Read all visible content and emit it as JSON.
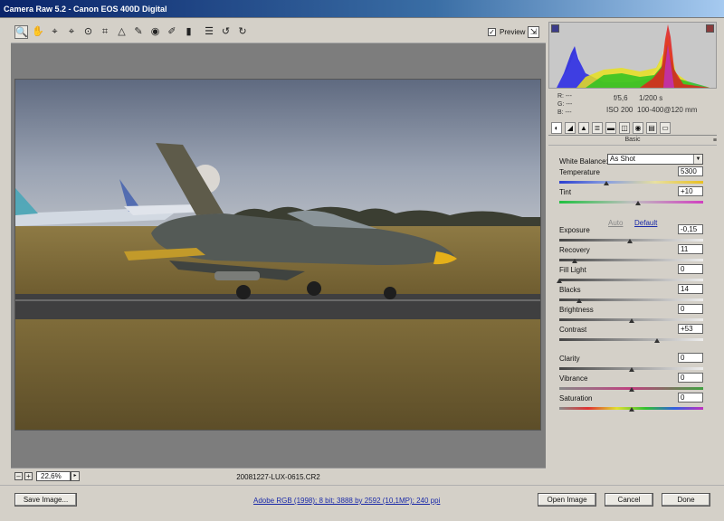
{
  "window": {
    "title": "Camera Raw 5.2  -  Canon EOS 400D Digital"
  },
  "toolbar": {
    "tools": [
      {
        "name": "zoom-tool-icon",
        "glyph": "🔍"
      },
      {
        "name": "hand-tool-icon",
        "glyph": "✋"
      },
      {
        "name": "white-balance-tool-icon",
        "glyph": "⌖"
      },
      {
        "name": "color-sampler-tool-icon",
        "glyph": "⌖"
      },
      {
        "name": "targeted-adjustment-tool-icon",
        "glyph": "⊙"
      },
      {
        "name": "crop-tool-icon",
        "glyph": "⌗"
      },
      {
        "name": "straighten-tool-icon",
        "glyph": "△"
      },
      {
        "name": "spot-removal-tool-icon",
        "glyph": "✎"
      },
      {
        "name": "red-eye-removal-tool-icon",
        "glyph": "◉"
      },
      {
        "name": "adjustment-brush-icon",
        "glyph": "✐"
      },
      {
        "name": "graduated-filter-icon",
        "glyph": "▮"
      },
      {
        "name": "preferences-icon",
        "glyph": "☰"
      },
      {
        "name": "rotate-left-icon",
        "glyph": "↺"
      },
      {
        "name": "rotate-right-icon",
        "glyph": "↻"
      }
    ],
    "preview_label": "Preview",
    "preview_checked": "✓"
  },
  "status": {
    "zoom": "22,6%",
    "filename": "20081227-LUX-0615.CR2",
    "zoom_out": "–",
    "zoom_in": "+",
    "zoom_menu": "▸"
  },
  "readout": {
    "r": "R:   ---",
    "g": "G:   ---",
    "b": "B:   ---",
    "aperture": "f/5,6",
    "shutter": "1/200 s",
    "iso": "ISO 200",
    "lens": "100-400@120 mm"
  },
  "panel": {
    "section_title": "Basic",
    "menu_glyph": "≡",
    "white_balance_label": "White Balance:",
    "white_balance_value": "As Shot",
    "auto_label": "Auto",
    "default_label": "Default",
    "sliders": [
      {
        "key": "temperature",
        "label": "Temperature",
        "value": "5300",
        "pos": 0.33,
        "grad": "linear-gradient(to right,#2b3fd0,#8aa0e0,#e8e0a0,#e8c020)"
      },
      {
        "key": "tint",
        "label": "Tint",
        "value": "+10",
        "pos": 0.55,
        "grad": "linear-gradient(to right,#20c040,#c0c0c0,#d040c0)"
      },
      {
        "key": "exposure",
        "label": "Exposure",
        "value": "-0,15",
        "pos": 0.49,
        "grad": "linear-gradient(to right,#444,#eee)"
      },
      {
        "key": "recovery",
        "label": "Recovery",
        "value": "11",
        "pos": 0.11,
        "grad": "linear-gradient(to right,#444,#eee)"
      },
      {
        "key": "fill-light",
        "label": "Fill Light",
        "value": "0",
        "pos": 0.0,
        "grad": "linear-gradient(to right,#444,#eee)"
      },
      {
        "key": "blacks",
        "label": "Blacks",
        "value": "14",
        "pos": 0.14,
        "grad": "linear-gradient(to right,#444,#eee)"
      },
      {
        "key": "brightness",
        "label": "Brightness",
        "value": "0",
        "pos": 0.5,
        "grad": "linear-gradient(to right,#444,#eee)"
      },
      {
        "key": "contrast",
        "label": "Contrast",
        "value": "+53",
        "pos": 0.68,
        "grad": "linear-gradient(to right,#444,#eee)"
      },
      {
        "key": "clarity",
        "label": "Clarity",
        "value": "0",
        "pos": 0.5,
        "grad": "linear-gradient(to right,#444,#eee)"
      },
      {
        "key": "vibrance",
        "label": "Vibrance",
        "value": "0",
        "pos": 0.5,
        "grad": "linear-gradient(to right,#888,#c04080,#40a040)"
      },
      {
        "key": "saturation",
        "label": "Saturation",
        "value": "0",
        "pos": 0.5,
        "grad": "linear-gradient(to right,#888,#e03030,#e0e030,#30c030,#3060e0,#c030c0)"
      }
    ],
    "tabs": [
      {
        "name": "tab-basic",
        "glyph": "◐"
      },
      {
        "name": "tab-tone-curve",
        "glyph": "◢"
      },
      {
        "name": "tab-detail",
        "glyph": "▲"
      },
      {
        "name": "tab-hsl",
        "glyph": "≣"
      },
      {
        "name": "tab-split-toning",
        "glyph": "▬"
      },
      {
        "name": "tab-lens-corrections",
        "glyph": "◫"
      },
      {
        "name": "tab-camera-calibration",
        "glyph": "◉"
      },
      {
        "name": "tab-presets",
        "glyph": "▤"
      },
      {
        "name": "tab-snapshots",
        "glyph": "▭"
      }
    ]
  },
  "bottom": {
    "save_label": "Save Image...",
    "info_text": "Adobe RGB (1998); 8 bit; 3888 by 2592 (10,1MP); 240 ppi",
    "open_label": "Open Image",
    "cancel_label": "Cancel",
    "done_label": "Done"
  },
  "colors": {
    "title_bar": "#0a246a",
    "panel_bg": "#d4d0c8",
    "canvas_bg": "#7d7d7d",
    "link": "#1a2aa8"
  }
}
